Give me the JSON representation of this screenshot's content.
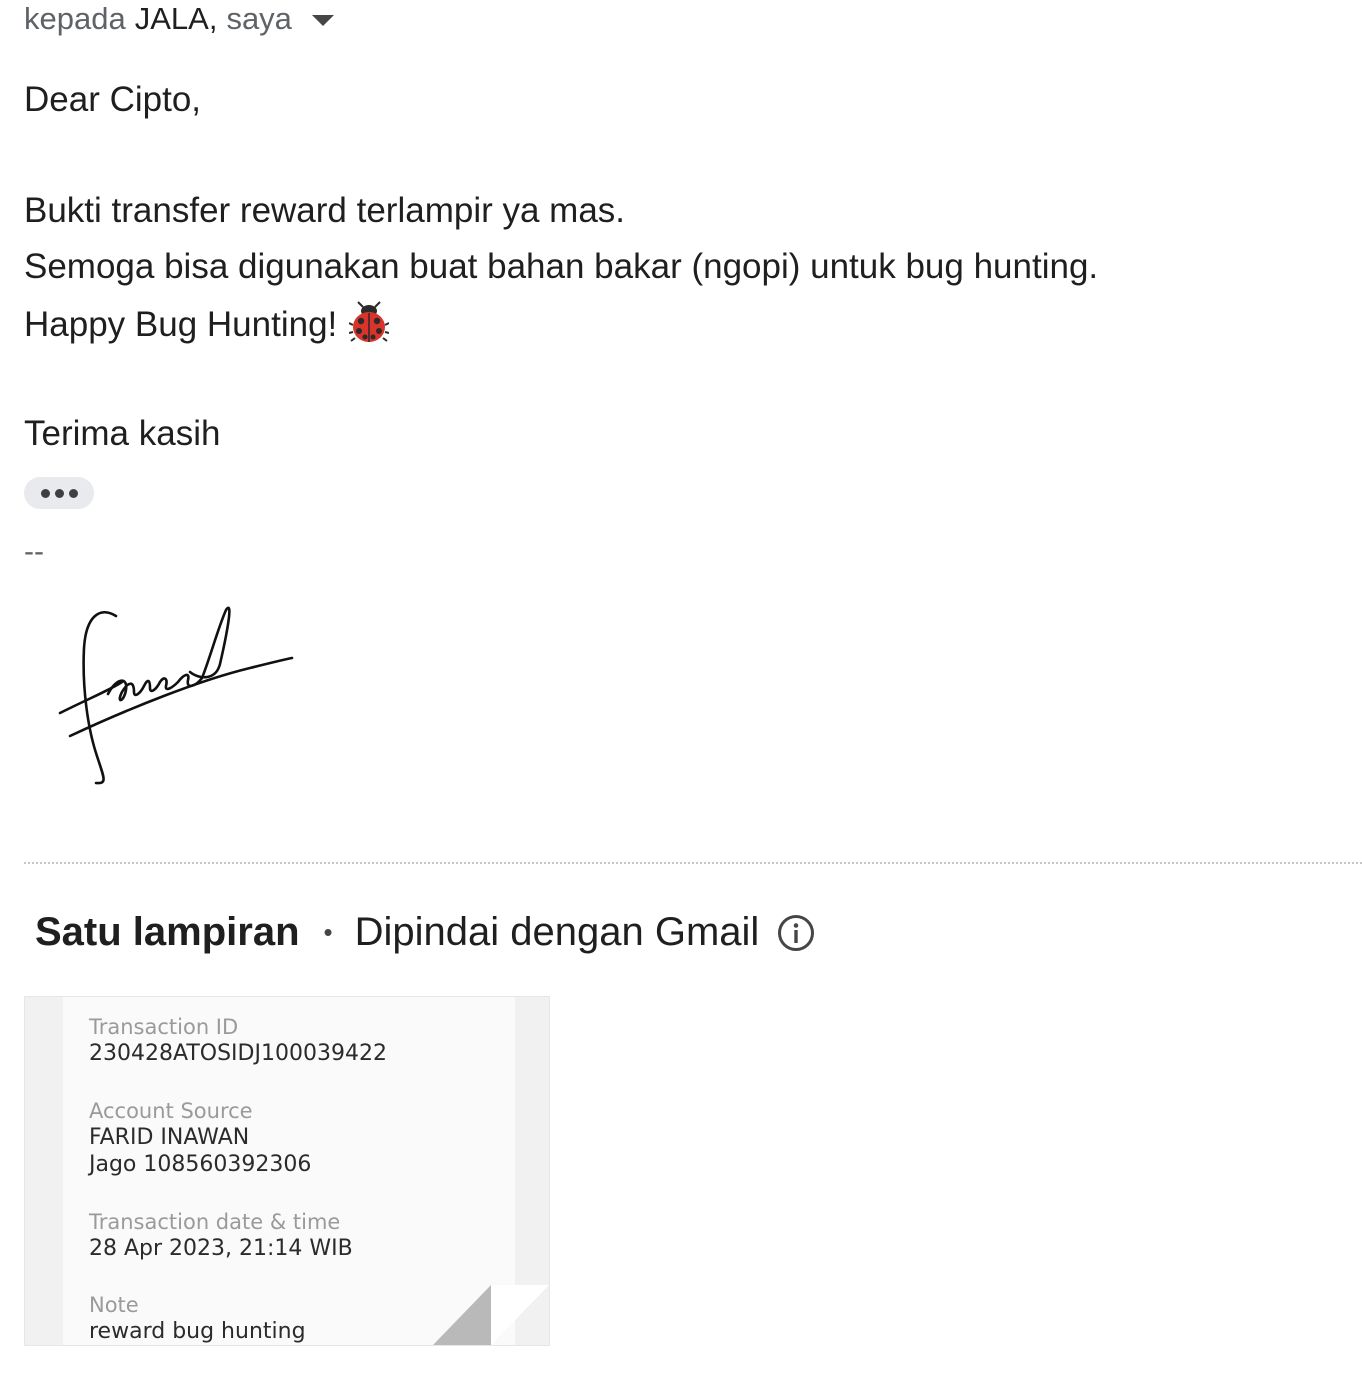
{
  "header": {
    "recipients_prefix": "kepada",
    "recipients_names": "JALA,",
    "recipients_me": "saya",
    "expand_icon": "caret-down-icon"
  },
  "body": {
    "greeting": "Dear Cipto,",
    "line1": "Bukti transfer reward terlampir ya mas.",
    "line2": "Semoga bisa digunakan buat bahan bakar (ngopi) untuk bug hunting.",
    "line3": "Happy Bug Hunting!",
    "line3_emoji_icon": "ladybug-icon",
    "closing": "Terima kasih"
  },
  "quoted_toggle_icon": "more-horizontal-icon",
  "signature": {
    "separator": "--",
    "image": "handwritten-signature"
  },
  "attachments": {
    "count_label": "Satu lampiran",
    "scanned_label": "Dipindai dengan Gmail",
    "info_icon": "info-icon",
    "preview": {
      "transaction_id_label": "Transaction ID",
      "transaction_id": "230428ATOSIDJ100039422",
      "account_source_label": "Account Source",
      "account_name": "FARID INAWAN",
      "account_number": "Jago 108560392306",
      "datetime_label": "Transaction date & time",
      "datetime": "28 Apr 2023, 21:14 WIB",
      "note_label": "Note",
      "note": "reward bug hunting"
    }
  }
}
